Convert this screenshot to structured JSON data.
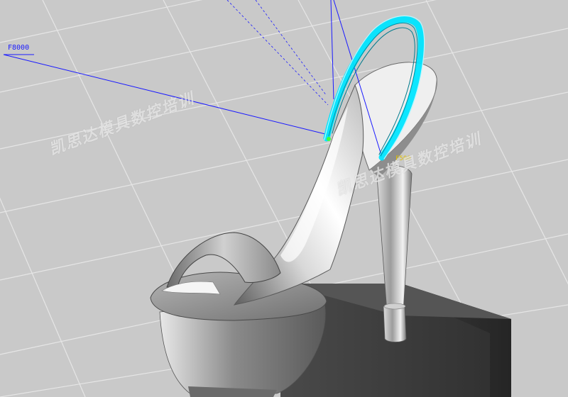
{
  "viewport": {
    "background_color": "#c9c9c9",
    "grid_color": "#e6e6e6",
    "model_color": "#9a9a9a",
    "toolpath_color": "#00e5ff",
    "feed_line_color": "#1a1aff"
  },
  "toolpath": {
    "feed_label": "F8000",
    "label_near_heel": "F500"
  },
  "watermarks": [
    {
      "text": "凯思达模具数控培训"
    },
    {
      "text": "凯思达模具数控培训"
    }
  ]
}
